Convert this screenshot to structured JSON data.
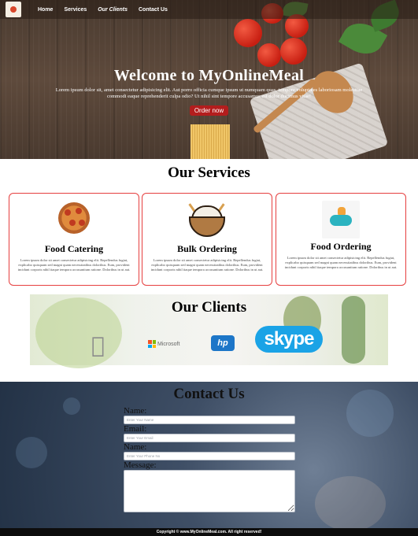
{
  "nav": {
    "logo": "logo",
    "links": [
      "Home",
      "Services",
      "Our Clients",
      "Contact Us"
    ]
  },
  "hero": {
    "title": "Welcome to MyOnlineMeal",
    "description": "Lorem ipsum dolor sit, amet consectetur adipisicing elit. Aut porro officia cumque ipsum ut numquam quas, tempore voluptates laboriosam molestiae commodi eaque reprehenderit culpa odio? Ut nihil sint tempore accusamus est dolor ducimus vitae!",
    "button": "Order now"
  },
  "services": {
    "title": "Our Services",
    "cards": [
      {
        "title": "Food Catering",
        "icon": "pizza-icon",
        "desc": "Lorem ipsum dolor sit amet consectetur adipisicing elit. Repellendus fugiat, explicabo quisquam sed magni quam necessitatibus doloribus. Eum, provident incidunt corporis nihil itaque tempora accusantium ratione. Doloribus in ut aut."
      },
      {
        "title": "Bulk Ordering",
        "icon": "rice-bowl-icon",
        "desc": "Lorem ipsum dolor sit amet consectetur adipisicing elit. Repellendus fugiat, explicabo quisquam sed magni quam necessitatibus doloribus. Eum, provident incidunt corporis nihil itaque tempora accusantium ratione. Doloribus in ut aut."
      },
      {
        "title": "Food Ordering",
        "icon": "delivery-scooter-icon",
        "desc": "Lorem ipsum dolor sit amet consectetur adipisicing elit. Repellendus fugiat, explicabo quisquam sed magni quam necessitatibus doloribus. Eum, provident incidunt corporis nihil itaque tempora accusantium ratione. Doloribus in ut aut."
      }
    ]
  },
  "clients": {
    "title": "Our Clients",
    "logos": {
      "apple": "",
      "microsoft": "Microsoft",
      "hp": "hp",
      "skype": "skype"
    }
  },
  "contact": {
    "title": "Contact Us",
    "name_label": "Name:",
    "name_placeholder": "Enter Your Name",
    "email_label": "Email:",
    "email_placeholder": "Enter Your Email",
    "phone_label": "Name:",
    "phone_placeholder": "Enter Your Phone No",
    "message_label": "Message:"
  },
  "footer": {
    "text": "Copyright © www.MyOnlineMeal.com. All right reserved!"
  },
  "colors": {
    "accent": "#b31d1d",
    "card_border": "#e63f3f",
    "footer_bg": "#0d0d0d"
  }
}
